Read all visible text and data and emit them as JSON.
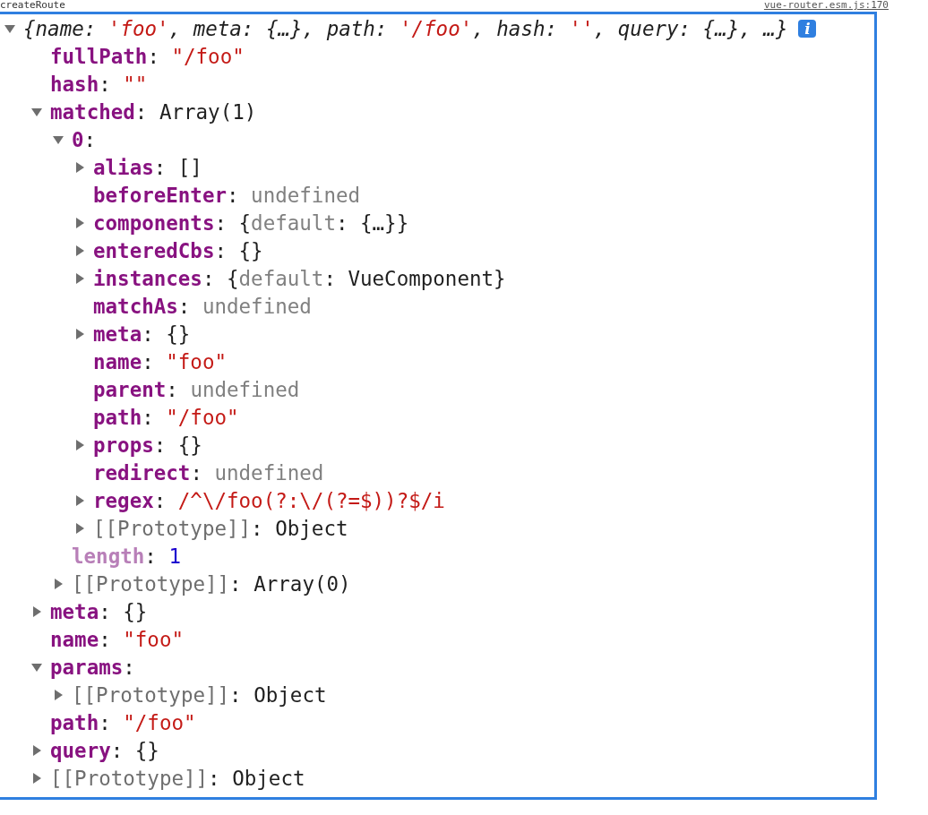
{
  "header": {
    "function_name": "createRoute",
    "source_link": "vue-router.esm.js:170"
  },
  "root": {
    "expanded": true,
    "preview": [
      {
        "text": "{name: ",
        "kind": "plain"
      },
      {
        "text": "'foo'",
        "kind": "string"
      },
      {
        "text": ", meta: {…}, path: ",
        "kind": "plain"
      },
      {
        "text": "'/foo'",
        "kind": "string"
      },
      {
        "text": ", hash: ",
        "kind": "plain"
      },
      {
        "text": "''",
        "kind": "string"
      },
      {
        "text": ", query: {…}, …}",
        "kind": "plain"
      }
    ],
    "info_badge": "i",
    "children": [
      {
        "key": "fullPath",
        "kind": "own",
        "value": [
          {
            "text": ": ",
            "kind": "plain"
          },
          {
            "text": "\"/foo\"",
            "kind": "string"
          }
        ]
      },
      {
        "key": "hash",
        "kind": "own",
        "value": [
          {
            "text": ": ",
            "kind": "plain"
          },
          {
            "text": "\"\"",
            "kind": "string"
          }
        ]
      },
      {
        "key": "matched",
        "kind": "own",
        "expanded": true,
        "value": [
          {
            "text": ": Array(1)",
            "kind": "plain"
          }
        ],
        "children": [
          {
            "key": "0",
            "kind": "own",
            "expanded": true,
            "value": [
              {
                "text": ":",
                "kind": "plain"
              }
            ],
            "children": [
              {
                "key": "alias",
                "kind": "own",
                "expanded": false,
                "value": [
                  {
                    "text": ": []",
                    "kind": "plain"
                  }
                ]
              },
              {
                "key": "beforeEnter",
                "kind": "own",
                "value": [
                  {
                    "text": ": ",
                    "kind": "plain"
                  },
                  {
                    "text": "undefined",
                    "kind": "muted"
                  }
                ]
              },
              {
                "key": "components",
                "kind": "own",
                "expanded": false,
                "value": [
                  {
                    "text": ": {",
                    "kind": "plain"
                  },
                  {
                    "text": "default",
                    "kind": "muted"
                  },
                  {
                    "text": ": {…}}",
                    "kind": "plain"
                  }
                ]
              },
              {
                "key": "enteredCbs",
                "kind": "own",
                "expanded": false,
                "value": [
                  {
                    "text": ": {}",
                    "kind": "plain"
                  }
                ]
              },
              {
                "key": "instances",
                "kind": "own",
                "expanded": false,
                "value": [
                  {
                    "text": ": {",
                    "kind": "plain"
                  },
                  {
                    "text": "default",
                    "kind": "muted"
                  },
                  {
                    "text": ": VueComponent}",
                    "kind": "plain"
                  }
                ]
              },
              {
                "key": "matchAs",
                "kind": "own",
                "value": [
                  {
                    "text": ": ",
                    "kind": "plain"
                  },
                  {
                    "text": "undefined",
                    "kind": "muted"
                  }
                ]
              },
              {
                "key": "meta",
                "kind": "own",
                "expanded": false,
                "value": [
                  {
                    "text": ": {}",
                    "kind": "plain"
                  }
                ]
              },
              {
                "key": "name",
                "kind": "own",
                "value": [
                  {
                    "text": ": ",
                    "kind": "plain"
                  },
                  {
                    "text": "\"foo\"",
                    "kind": "string"
                  }
                ]
              },
              {
                "key": "parent",
                "kind": "own",
                "value": [
                  {
                    "text": ": ",
                    "kind": "plain"
                  },
                  {
                    "text": "undefined",
                    "kind": "muted"
                  }
                ]
              },
              {
                "key": "path",
                "kind": "own",
                "value": [
                  {
                    "text": ": ",
                    "kind": "plain"
                  },
                  {
                    "text": "\"/foo\"",
                    "kind": "string"
                  }
                ]
              },
              {
                "key": "props",
                "kind": "own",
                "expanded": false,
                "value": [
                  {
                    "text": ": {}",
                    "kind": "plain"
                  }
                ]
              },
              {
                "key": "redirect",
                "kind": "own",
                "value": [
                  {
                    "text": ": ",
                    "kind": "plain"
                  },
                  {
                    "text": "undefined",
                    "kind": "muted"
                  }
                ]
              },
              {
                "key": "regex",
                "kind": "own",
                "expanded": false,
                "value": [
                  {
                    "text": ": ",
                    "kind": "plain"
                  },
                  {
                    "text": "/^\\/foo(?:\\/(?=$))?$/i",
                    "kind": "string"
                  }
                ]
              },
              {
                "key": "[[Prototype]]",
                "kind": "internal",
                "expanded": false,
                "value": [
                  {
                    "text": ": Object",
                    "kind": "plain"
                  }
                ]
              }
            ]
          },
          {
            "key": "length",
            "kind": "hidden",
            "value": [
              {
                "text": ": ",
                "kind": "plain"
              },
              {
                "text": "1",
                "kind": "number"
              }
            ]
          },
          {
            "key": "[[Prototype]]",
            "kind": "internal",
            "expanded": false,
            "value": [
              {
                "text": ": Array(0)",
                "kind": "plain"
              }
            ]
          }
        ]
      },
      {
        "key": "meta",
        "kind": "own",
        "expanded": false,
        "value": [
          {
            "text": ": {}",
            "kind": "plain"
          }
        ]
      },
      {
        "key": "name",
        "kind": "own",
        "value": [
          {
            "text": ": ",
            "kind": "plain"
          },
          {
            "text": "\"foo\"",
            "kind": "string"
          }
        ]
      },
      {
        "key": "params",
        "kind": "own",
        "expanded": true,
        "value": [
          {
            "text": ":",
            "kind": "plain"
          }
        ],
        "children": [
          {
            "key": "[[Prototype]]",
            "kind": "internal",
            "expanded": false,
            "value": [
              {
                "text": ": Object",
                "kind": "plain"
              }
            ]
          }
        ]
      },
      {
        "key": "path",
        "kind": "own",
        "value": [
          {
            "text": ": ",
            "kind": "plain"
          },
          {
            "text": "\"/foo\"",
            "kind": "string"
          }
        ]
      },
      {
        "key": "query",
        "kind": "own",
        "expanded": false,
        "value": [
          {
            "text": ": {}",
            "kind": "plain"
          }
        ]
      },
      {
        "key": "[[Prototype]]",
        "kind": "internal",
        "expanded": false,
        "value": [
          {
            "text": ": Object",
            "kind": "plain"
          }
        ]
      }
    ]
  }
}
